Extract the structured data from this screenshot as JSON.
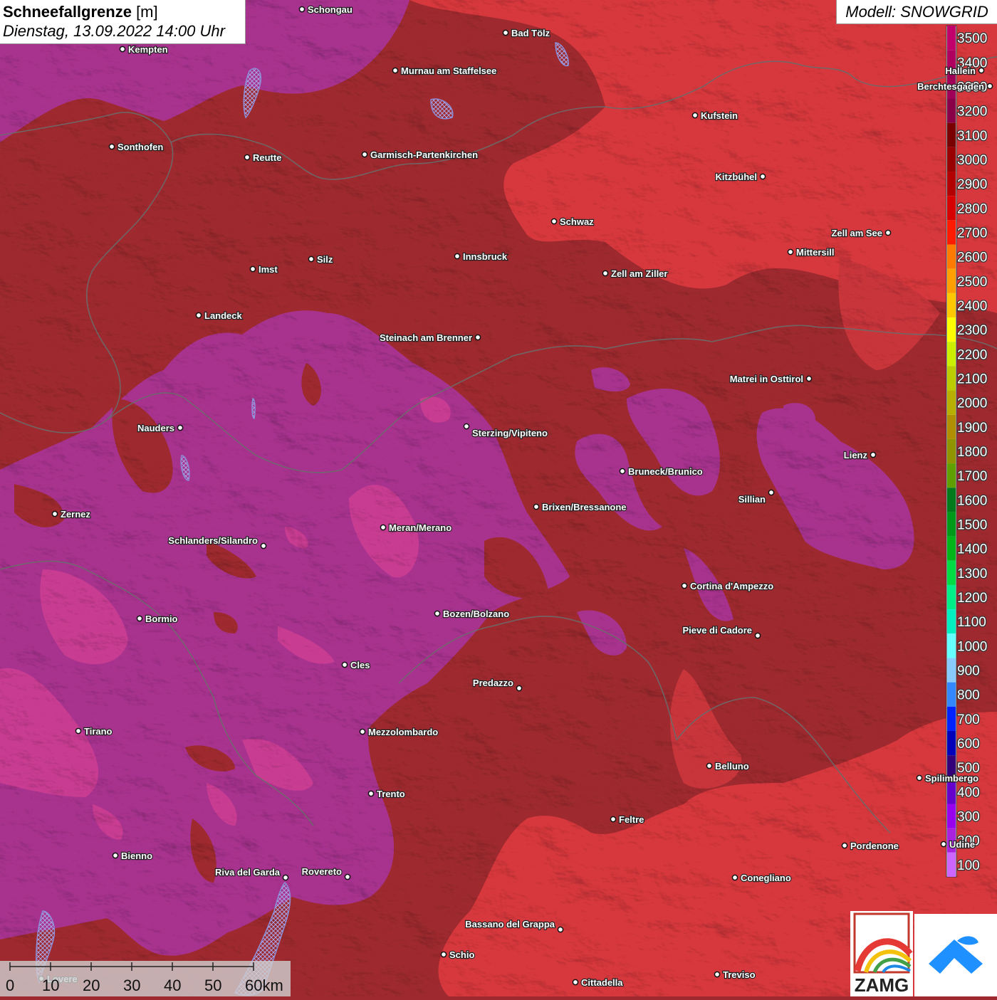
{
  "header": {
    "title_bold": "Schneefallgrenze",
    "title_unit": " [m]",
    "datetime": "Dienstag, 13.09.2022 14:00 Uhr",
    "model": "Modell: SNOWGRID"
  },
  "legend": {
    "levels": [
      {
        "label": "3500",
        "color": "#c2006b"
      },
      {
        "label": "3400",
        "color": "#b0005f"
      },
      {
        "label": "3300",
        "color": "#a00057"
      },
      {
        "label": "3200",
        "color": "#8a0048"
      },
      {
        "label": "3100",
        "color": "#7a0000"
      },
      {
        "label": "3000",
        "color": "#990000"
      },
      {
        "label": "2900",
        "color": "#b30000"
      },
      {
        "label": "2800",
        "color": "#d60000"
      },
      {
        "label": "2700",
        "color": "#ff1a00"
      },
      {
        "label": "2600",
        "color": "#ff7a00"
      },
      {
        "label": "2500",
        "color": "#ff9f00"
      },
      {
        "label": "2400",
        "color": "#ffc800"
      },
      {
        "label": "2300",
        "color": "#ffff00"
      },
      {
        "label": "2200",
        "color": "#ccee00"
      },
      {
        "label": "2100",
        "color": "#bbcc00"
      },
      {
        "label": "2000",
        "color": "#b8b000"
      },
      {
        "label": "1900",
        "color": "#b09000"
      },
      {
        "label": "1800",
        "color": "#909400"
      },
      {
        "label": "1700",
        "color": "#5fa000"
      },
      {
        "label": "1600",
        "color": "#007a1a"
      },
      {
        "label": "1500",
        "color": "#009a1a"
      },
      {
        "label": "1400",
        "color": "#00b51a"
      },
      {
        "label": "1300",
        "color": "#00dd44"
      },
      {
        "label": "1200",
        "color": "#00ee88"
      },
      {
        "label": "1100",
        "color": "#00eec0"
      },
      {
        "label": "1000",
        "color": "#66ffff"
      },
      {
        "label": "900",
        "color": "#88ccff"
      },
      {
        "label": "800",
        "color": "#3388ff"
      },
      {
        "label": "700",
        "color": "#0022ff"
      },
      {
        "label": "600",
        "color": "#0000bb"
      },
      {
        "label": "500",
        "color": "#33007a"
      },
      {
        "label": "400",
        "color": "#6600cc"
      },
      {
        "label": "300",
        "color": "#9900ee"
      },
      {
        "label": "200",
        "color": "#aa22dd"
      },
      {
        "label": "100",
        "color": "#cc66ff"
      }
    ]
  },
  "scalebar": {
    "labels": [
      "0",
      "10",
      "20",
      "30",
      "40",
      "50",
      "60km"
    ]
  },
  "cities": [
    {
      "name": "Schongau"
    },
    {
      "name": "Kempten"
    },
    {
      "name": "Bad Tölz"
    },
    {
      "name": "Murnau am Staffelsee"
    },
    {
      "name": "Kufstein"
    },
    {
      "name": "Sonthofen"
    },
    {
      "name": "Reutte"
    },
    {
      "name": "Garmisch-Partenkirchen"
    },
    {
      "name": "Kitzbühel"
    },
    {
      "name": "Berchtesgaden"
    },
    {
      "name": "Hallein"
    },
    {
      "name": "Schwaz"
    },
    {
      "name": "Zell am See"
    },
    {
      "name": "Mittersill"
    },
    {
      "name": "Innsbruck"
    },
    {
      "name": "Imst"
    },
    {
      "name": "Silz"
    },
    {
      "name": "Zell am Ziller"
    },
    {
      "name": "Landeck"
    },
    {
      "name": "Steinach am Brenner"
    },
    {
      "name": "Matrei in Osttirol"
    },
    {
      "name": "Nauders"
    },
    {
      "name": "Sterzing/Vipiteno"
    },
    {
      "name": "Lienz"
    },
    {
      "name": "Bruneck/Brunico"
    },
    {
      "name": "Sillian"
    },
    {
      "name": "Zernez"
    },
    {
      "name": "Brixen/Bressanone"
    },
    {
      "name": "Meran/Merano"
    },
    {
      "name": "Schlanders/Silandro"
    },
    {
      "name": "Cortina d'Ampezzo"
    },
    {
      "name": "Bozen/Bolzano"
    },
    {
      "name": "Bormio"
    },
    {
      "name": "Pieve di Cadore"
    },
    {
      "name": "Cles"
    },
    {
      "name": "Predazzo"
    },
    {
      "name": "Tirano"
    },
    {
      "name": "Mezzolombardo"
    },
    {
      "name": "Belluno"
    },
    {
      "name": "Spilimbergo"
    },
    {
      "name": "Trento"
    },
    {
      "name": "Feltre"
    },
    {
      "name": "Pordenone"
    },
    {
      "name": "Bienno"
    },
    {
      "name": "Riva del Garda"
    },
    {
      "name": "Rovereto"
    },
    {
      "name": "Conegliano"
    },
    {
      "name": "Bassano del Grappa"
    },
    {
      "name": "Schio"
    },
    {
      "name": "Treviso"
    },
    {
      "name": "Cittadella"
    },
    {
      "name": "Lovere"
    },
    {
      "name": "Udine"
    }
  ],
  "logos": {
    "zamg": "ZAMG"
  },
  "colors": {
    "base_dark_red": "#9e2a2f",
    "bright_red": "#d7383d",
    "magenta": "#a8338f",
    "pink": "#c83c92",
    "lake_blue": "#8c8ed8"
  }
}
